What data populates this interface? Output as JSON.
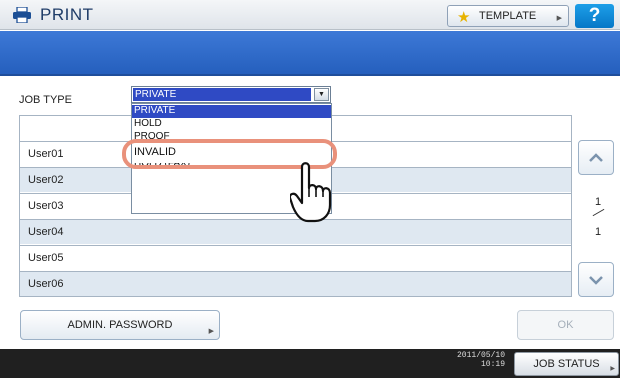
{
  "header": {
    "title": "PRINT",
    "template_label": "TEMPLATE",
    "help_label": "?"
  },
  "job_type": {
    "label": "JOB TYPE",
    "selected": "PRIVATE",
    "options": [
      "PRIVATE",
      "HOLD",
      "PROOF",
      "INVALID",
      "HOLD (FAX)"
    ],
    "highlighted_option": "INVALID"
  },
  "table": {
    "rows": [
      "User01",
      "User02",
      "User03",
      "User04",
      "User05",
      "User06"
    ]
  },
  "pagination": {
    "current": "1",
    "total": "1"
  },
  "buttons": {
    "admin_password": "ADMIN. PASSWORD",
    "ok": "OK",
    "job_status": "JOB STATUS"
  },
  "status": {
    "date": "2011/05/10",
    "time": "10:19"
  },
  "colors": {
    "banner": "#255fbd",
    "selection": "#2f4ac4",
    "highlight_ring": "#e9917b",
    "help_button": "#0677c7"
  }
}
